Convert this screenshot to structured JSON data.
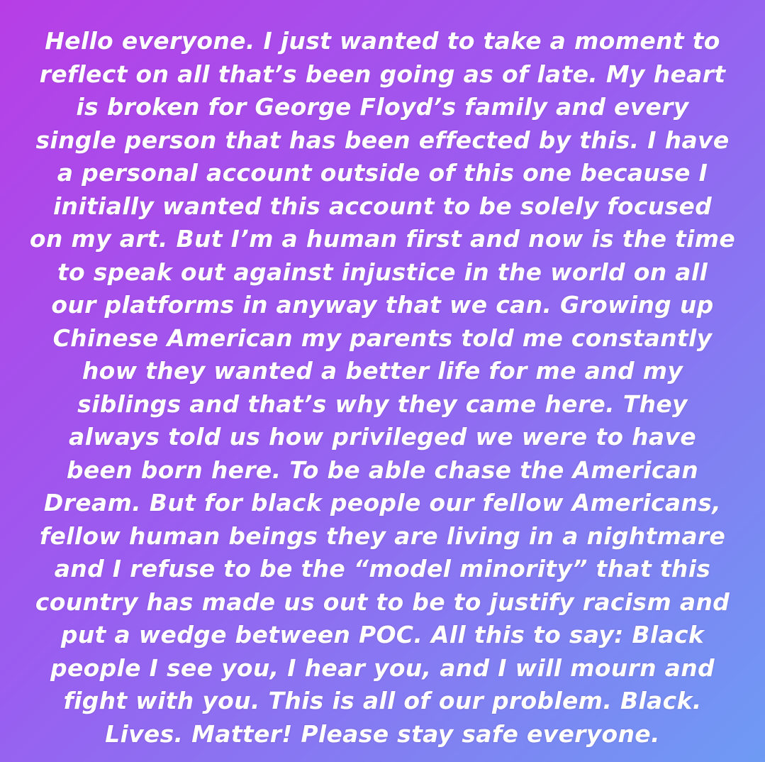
{
  "story": {
    "lines": [
      "Hello everyone. I just wanted to take a moment to",
      "reflect on all that’s been going as of late. My heart",
      "is broken for George Floyd’s family and every",
      "single person that has been effected by this. I have",
      "a personal account outside of this one because I",
      "initially wanted this account to be solely focused",
      "on my art. But I’m a human first and now is the time",
      "to speak out against injustice in the world on all",
      "our platforms in anyway that we can. Growing up",
      "Chinese American my parents told me constantly",
      "how they wanted a better life for me and my",
      "siblings and that’s why they came here. They",
      "always told us how privileged we were to have",
      "been born here. To be able chase the American",
      "Dream. But for black people our fellow Americans,",
      "fellow human beings they are living in a nightmare",
      "and I refuse to be the “model minority” that this",
      "country has made us out to be to justify racism and",
      "put a wedge between POC. All this to say: Black",
      "people I see you, I hear you, and I will mourn and",
      "fight with you. This is all of our problem. Black.",
      "Lives. Matter! Please stay safe everyone."
    ]
  },
  "colors": {
    "gradient_start": "#b73ee6",
    "gradient_mid": "#9a5df0",
    "gradient_end": "#6e9bf4",
    "text": "#ffffff"
  }
}
